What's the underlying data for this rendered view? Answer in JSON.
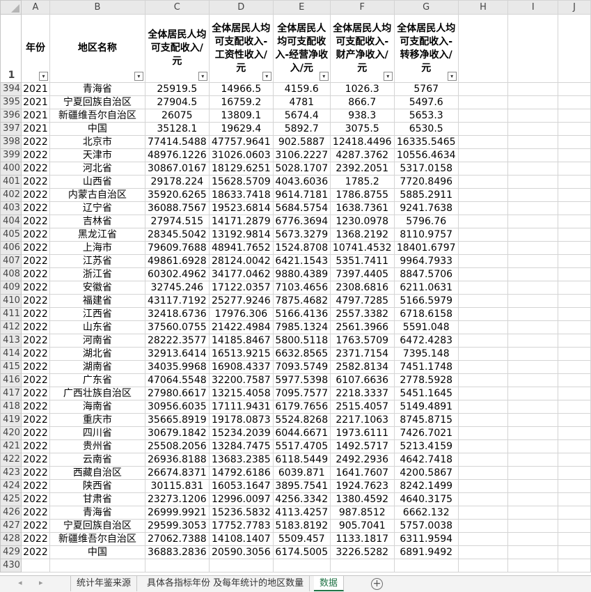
{
  "columns": [
    "A",
    "B",
    "C",
    "D",
    "E",
    "F",
    "G",
    "H",
    "I",
    "J"
  ],
  "header_row_number": "1",
  "headers": {
    "year": "年份",
    "region": "地区名称",
    "c": "全体居民人均可支配收入/元",
    "d": "全体居民人均可支配收入-工资性收入/元",
    "e": "全体居民人均可支配收入-经营净收入/元",
    "f": "全体居民人均可支配收入-财产净收入/元",
    "g": "全体居民人均可支配收入-转移净收入/元"
  },
  "rows": [
    {
      "n": "394",
      "a": "2021",
      "b": "青海省",
      "c": "25919.5",
      "d": "14966.5",
      "e": "4159.6",
      "f": "1026.3",
      "g": "5767"
    },
    {
      "n": "395",
      "a": "2021",
      "b": "宁夏回族自治区",
      "c": "27904.5",
      "d": "16759.2",
      "e": "4781",
      "f": "866.7",
      "g": "5497.6"
    },
    {
      "n": "396",
      "a": "2021",
      "b": "新疆维吾尔自治区",
      "c": "26075",
      "d": "13809.1",
      "e": "5674.4",
      "f": "938.3",
      "g": "5653.3"
    },
    {
      "n": "397",
      "a": "2021",
      "b": "中国",
      "c": "35128.1",
      "d": "19629.4",
      "e": "5892.7",
      "f": "3075.5",
      "g": "6530.5"
    },
    {
      "n": "398",
      "a": "2022",
      "b": "北京市",
      "c": "77414.5488",
      "d": "47757.9641",
      "e": "902.5887",
      "f": "12418.4496",
      "g": "16335.5465"
    },
    {
      "n": "399",
      "a": "2022",
      "b": "天津市",
      "c": "48976.1226",
      "d": "31026.0603",
      "e": "3106.2227",
      "f": "4287.3762",
      "g": "10556.4634"
    },
    {
      "n": "400",
      "a": "2022",
      "b": "河北省",
      "c": "30867.0167",
      "d": "18129.6251",
      "e": "5028.1707",
      "f": "2392.2051",
      "g": "5317.0158"
    },
    {
      "n": "401",
      "a": "2022",
      "b": "山西省",
      "c": "29178.224",
      "d": "15628.5709",
      "e": "4043.6036",
      "f": "1785.2",
      "g": "7720.8496"
    },
    {
      "n": "402",
      "a": "2022",
      "b": "内蒙古自治区",
      "c": "35920.6265",
      "d": "18633.7418",
      "e": "9614.7181",
      "f": "1786.8755",
      "g": "5885.2911"
    },
    {
      "n": "403",
      "a": "2022",
      "b": "辽宁省",
      "c": "36088.7567",
      "d": "19523.6814",
      "e": "5684.5754",
      "f": "1638.7361",
      "g": "9241.7638"
    },
    {
      "n": "404",
      "a": "2022",
      "b": "吉林省",
      "c": "27974.515",
      "d": "14171.2879",
      "e": "6776.3694",
      "f": "1230.0978",
      "g": "5796.76"
    },
    {
      "n": "405",
      "a": "2022",
      "b": "黑龙江省",
      "c": "28345.5042",
      "d": "13192.9814",
      "e": "5673.3279",
      "f": "1368.2192",
      "g": "8110.9757"
    },
    {
      "n": "406",
      "a": "2022",
      "b": "上海市",
      "c": "79609.7688",
      "d": "48941.7652",
      "e": "1524.8708",
      "f": "10741.4532",
      "g": "18401.6797"
    },
    {
      "n": "407",
      "a": "2022",
      "b": "江苏省",
      "c": "49861.6928",
      "d": "28124.0042",
      "e": "6421.1543",
      "f": "5351.7411",
      "g": "9964.7933"
    },
    {
      "n": "408",
      "a": "2022",
      "b": "浙江省",
      "c": "60302.4962",
      "d": "34177.0462",
      "e": "9880.4389",
      "f": "7397.4405",
      "g": "8847.5706"
    },
    {
      "n": "409",
      "a": "2022",
      "b": "安徽省",
      "c": "32745.246",
      "d": "17122.0357",
      "e": "7103.4656",
      "f": "2308.6816",
      "g": "6211.0631"
    },
    {
      "n": "410",
      "a": "2022",
      "b": "福建省",
      "c": "43117.7192",
      "d": "25277.9246",
      "e": "7875.4682",
      "f": "4797.7285",
      "g": "5166.5979"
    },
    {
      "n": "411",
      "a": "2022",
      "b": "江西省",
      "c": "32418.6736",
      "d": "17976.306",
      "e": "5166.4136",
      "f": "2557.3382",
      "g": "6718.6158"
    },
    {
      "n": "412",
      "a": "2022",
      "b": "山东省",
      "c": "37560.0755",
      "d": "21422.4984",
      "e": "7985.1324",
      "f": "2561.3966",
      "g": "5591.048"
    },
    {
      "n": "413",
      "a": "2022",
      "b": "河南省",
      "c": "28222.3577",
      "d": "14185.8467",
      "e": "5800.5118",
      "f": "1763.5709",
      "g": "6472.4283"
    },
    {
      "n": "414",
      "a": "2022",
      "b": "湖北省",
      "c": "32913.6414",
      "d": "16513.9215",
      "e": "6632.8565",
      "f": "2371.7154",
      "g": "7395.148"
    },
    {
      "n": "415",
      "a": "2022",
      "b": "湖南省",
      "c": "34035.9968",
      "d": "16908.4337",
      "e": "7093.5749",
      "f": "2582.8134",
      "g": "7451.1748"
    },
    {
      "n": "416",
      "a": "2022",
      "b": "广东省",
      "c": "47064.5548",
      "d": "32200.7587",
      "e": "5977.5398",
      "f": "6107.6636",
      "g": "2778.5928"
    },
    {
      "n": "417",
      "a": "2022",
      "b": "广西壮族自治区",
      "c": "27980.6617",
      "d": "13215.4058",
      "e": "7095.7577",
      "f": "2218.3337",
      "g": "5451.1645"
    },
    {
      "n": "418",
      "a": "2022",
      "b": "海南省",
      "c": "30956.6035",
      "d": "17111.9431",
      "e": "6179.7656",
      "f": "2515.4057",
      "g": "5149.4891"
    },
    {
      "n": "419",
      "a": "2022",
      "b": "重庆市",
      "c": "35665.8919",
      "d": "19178.0873",
      "e": "5524.8268",
      "f": "2217.1063",
      "g": "8745.8715"
    },
    {
      "n": "420",
      "a": "2022",
      "b": "四川省",
      "c": "30679.1842",
      "d": "15234.2039",
      "e": "6044.6671",
      "f": "1973.6111",
      "g": "7426.7021"
    },
    {
      "n": "421",
      "a": "2022",
      "b": "贵州省",
      "c": "25508.2056",
      "d": "13284.7475",
      "e": "5517.4705",
      "f": "1492.5717",
      "g": "5213.4159"
    },
    {
      "n": "422",
      "a": "2022",
      "b": "云南省",
      "c": "26936.8188",
      "d": "13683.2385",
      "e": "6118.5449",
      "f": "2492.2936",
      "g": "4642.7418"
    },
    {
      "n": "423",
      "a": "2022",
      "b": "西藏自治区",
      "c": "26674.8371",
      "d": "14792.6186",
      "e": "6039.871",
      "f": "1641.7607",
      "g": "4200.5867"
    },
    {
      "n": "424",
      "a": "2022",
      "b": "陕西省",
      "c": "30115.831",
      "d": "16053.1647",
      "e": "3895.7541",
      "f": "1924.7623",
      "g": "8242.1499"
    },
    {
      "n": "425",
      "a": "2022",
      "b": "甘肃省",
      "c": "23273.1206",
      "d": "12996.0097",
      "e": "4256.3342",
      "f": "1380.4592",
      "g": "4640.3175"
    },
    {
      "n": "426",
      "a": "2022",
      "b": "青海省",
      "c": "26999.9921",
      "d": "15236.5832",
      "e": "4113.4257",
      "f": "987.8512",
      "g": "6662.132"
    },
    {
      "n": "427",
      "a": "2022",
      "b": "宁夏回族自治区",
      "c": "29599.3053",
      "d": "17752.7783",
      "e": "5183.8192",
      "f": "905.7041",
      "g": "5757.0038"
    },
    {
      "n": "428",
      "a": "2022",
      "b": "新疆维吾尔自治区",
      "c": "27062.7388",
      "d": "14108.1407",
      "e": "5509.457",
      "f": "1133.1817",
      "g": "6311.9594"
    },
    {
      "n": "429",
      "a": "2022",
      "b": "中国",
      "c": "36883.2836",
      "d": "20590.3056",
      "e": "6174.5005",
      "f": "3226.5282",
      "g": "6891.9492"
    },
    {
      "n": "430",
      "a": "",
      "b": "",
      "c": "",
      "d": "",
      "e": "",
      "f": "",
      "g": ""
    }
  ],
  "tabs": {
    "nav_prev": "◂",
    "nav_next": "▸",
    "tab1": "统计年鉴来源",
    "tab2": "具体各指标年份 及每年统计的地区数量",
    "tab3": "数据",
    "add": "+"
  },
  "colors": {
    "accent": "#217346",
    "header_bg": "#e9e9e9",
    "grid": "#d4d4d4"
  }
}
